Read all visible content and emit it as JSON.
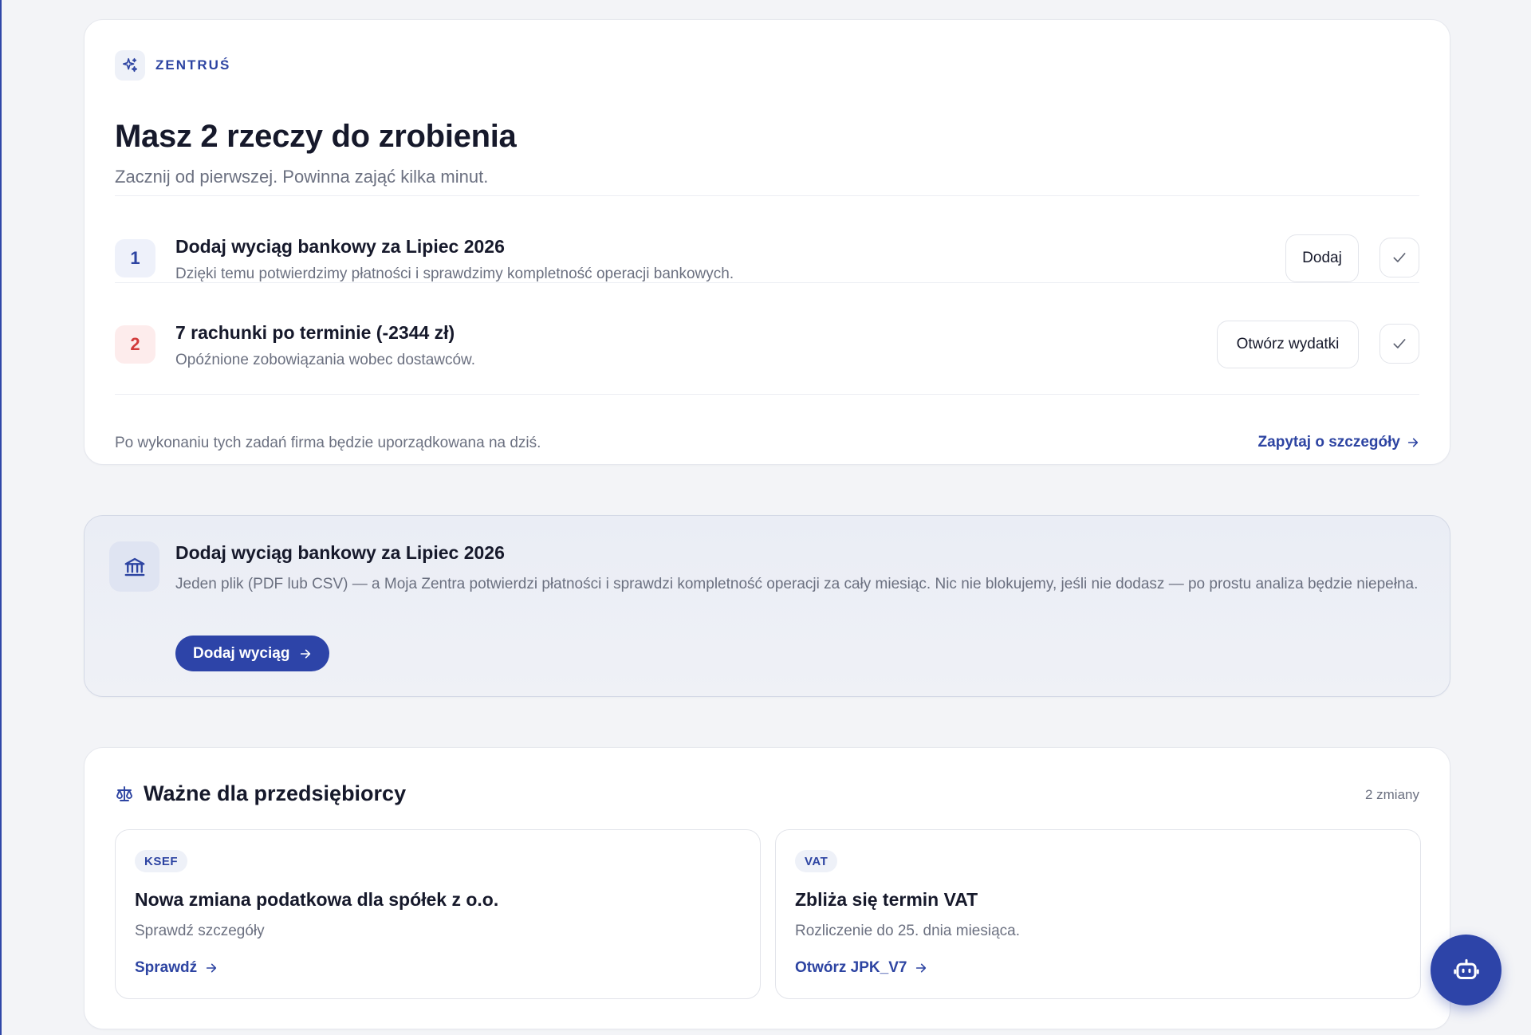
{
  "brand": {
    "name": "ZENTRUŚ",
    "icon": "sparkles-icon",
    "accent": "#2d44a2"
  },
  "todo": {
    "title": "Masz 2 rzeczy do zrobienia",
    "subtitle": "Zacznij od pierwszej. Powinna zająć kilka minut.",
    "tasks": [
      {
        "number": "1",
        "title": "Dodaj wyciąg bankowy za Lipiec 2026",
        "description": "Dzięki temu potwierdzimy płatności i sprawdzimy kompletność operacji bankowych.",
        "action_label": "Dodaj",
        "status_color": "#2d44a2"
      },
      {
        "number": "2",
        "title": "7 rachunki po terminie (-2344 zł)",
        "description": "Opóźnione zobowiązania wobec dostawców.",
        "action_label": "Otwórz wydatki",
        "status_color": "#d23b3b"
      }
    ],
    "footer_text": "Po wykonaniu tych zadań firma będzie uporządkowana na dziś.",
    "ask_link": "Zapytaj o szczegóły"
  },
  "bank_banner": {
    "icon": "bank-icon",
    "title": "Dodaj wyciąg bankowy za Lipiec 2026",
    "description": "Jeden plik (PDF lub CSV) — a Moja Zentra potwierdzi płatności i sprawdzi kompletność operacji za cały miesiąc. Nic nie blokujemy, jeśli nie dodasz — po prostu analiza będzie niepełna.",
    "button_label": "Dodaj wyciąg"
  },
  "news": {
    "icon": "scale-icon",
    "title": "Ważne dla przedsiębiorcy",
    "count": "2 zmiany",
    "items": [
      {
        "tag": "KSEF",
        "title": "Nowa zmiana podatkowa dla spółek z o.o.",
        "description": "Sprawdź szczegóły",
        "link": "Sprawdź"
      },
      {
        "tag": "VAT",
        "title": "Zbliża się termin VAT",
        "description": "Rozliczenie do 25. dnia miesiąca.",
        "link": "Otwórz JPK_V7"
      }
    ]
  },
  "assistant": {
    "icon": "robot-icon"
  }
}
